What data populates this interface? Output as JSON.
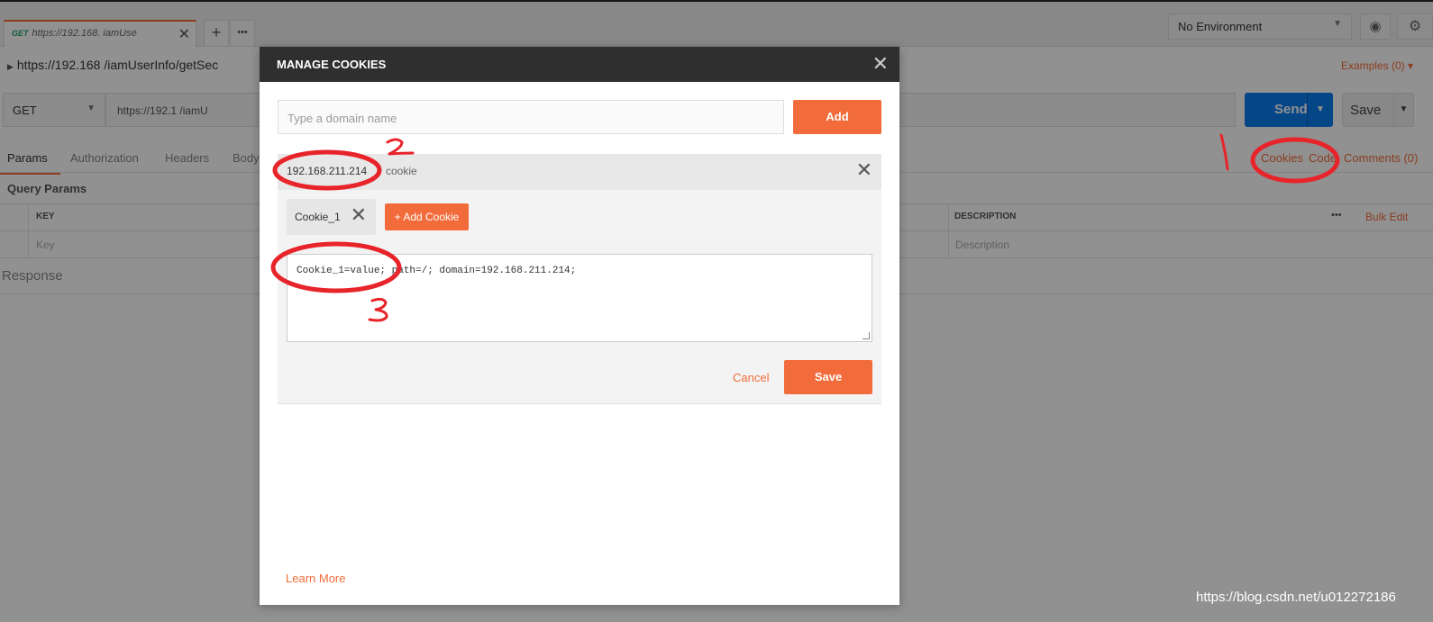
{
  "tab": {
    "method": "GET",
    "title": "https://192.168.       iamUse",
    "new_tab_symbol": "+",
    "more_symbol": "•••"
  },
  "environment": {
    "selected": "No Environment"
  },
  "request": {
    "title": "https://192.168        /iamUserInfo/getSec",
    "examples_label": "Examples (0)",
    "method": "GET",
    "url": "https://192.1            /iamU",
    "send_label": "Send",
    "save_label": "Save"
  },
  "subtabs": {
    "params": "Params",
    "authorization": "Authorization",
    "headers": "Headers",
    "body": "Body"
  },
  "right_links": {
    "cookies": "Cookies",
    "code": "Code",
    "comments": "Comments (0)"
  },
  "params": {
    "title": "Query Params",
    "key_header": "KEY",
    "description_header": "DESCRIPTION",
    "bulk_edit": "Bulk Edit",
    "key_placeholder": "Key",
    "description_placeholder": "Description",
    "more_symbol": "•••"
  },
  "response": {
    "title": "Response"
  },
  "modal": {
    "title": "MANAGE COOKIES",
    "domain_placeholder": "Type a domain name",
    "add_label": "Add",
    "domain": "192.168.211.214",
    "domain_cookie_count": "cookie",
    "cookie_name": "Cookie_1",
    "add_cookie_label": "+ Add Cookie",
    "cookie_string": "Cookie_1=value; path=/; domain=192.168.211.214;",
    "cancel_label": "Cancel",
    "save_label": "Save",
    "learn_more": "Learn More"
  },
  "annotations": {
    "step1": "1",
    "step2": "2",
    "step3": "3"
  },
  "watermark": "https://blog.csdn.net/u012272186",
  "colors": {
    "accent": "#f26b3a",
    "send_blue": "#097bed",
    "modal_header": "#2f2f2f",
    "annotation_red": "#e8242b"
  },
  "icons": {
    "close": "close-icon",
    "eye": "eye-icon",
    "gear": "gear-icon",
    "caret": "chevron-down-icon"
  }
}
